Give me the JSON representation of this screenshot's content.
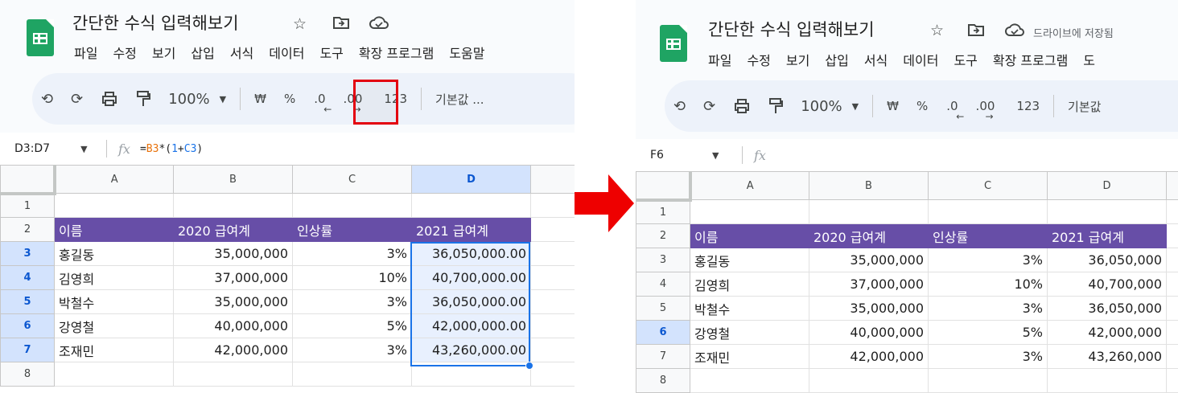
{
  "left": {
    "doc_title": "간단한 수식 입력해보기",
    "menu": [
      "파일",
      "수정",
      "보기",
      "삽입",
      "서식",
      "데이터",
      "도구",
      "확장 프로그램",
      "도움말"
    ],
    "toolbar": {
      "zoom": "100%",
      "currency": "₩",
      "percent": "%",
      "dec_decrease": ".0",
      "dec_increase": ".00",
      "num_format": "123",
      "font": "기본값 ..."
    },
    "name_box": "D3:D7",
    "fx_label": "fx",
    "formula": {
      "eq": "=",
      "ref1": "B3",
      "op1": "*(",
      "num": "1",
      "op2": "+",
      "ref2": "C3",
      "close": ")"
    },
    "columns": [
      "A",
      "B",
      "C",
      "D"
    ],
    "row_numbers": [
      "1",
      "2",
      "3",
      "4",
      "5",
      "6",
      "7",
      "8"
    ],
    "header": [
      "이름",
      "2020 급여계",
      "인상률",
      "2021 급여계"
    ],
    "rows": [
      [
        "홍길동",
        "35,000,000",
        "3%",
        "36,050,000.00"
      ],
      [
        "김영희",
        "37,000,000",
        "10%",
        "40,700,000.00"
      ],
      [
        "박철수",
        "35,000,000",
        "3%",
        "36,050,000.00"
      ],
      [
        "강영철",
        "40,000,000",
        "5%",
        "42,000,000.00"
      ],
      [
        "조재민",
        "42,000,000",
        "3%",
        "43,260,000.00"
      ]
    ]
  },
  "right": {
    "doc_title": "간단한 수식 입력해보기",
    "saved_status": "드라이브에 저장됨",
    "menu": [
      "파일",
      "수정",
      "보기",
      "삽입",
      "서식",
      "데이터",
      "도구",
      "확장 프로그램",
      "도"
    ],
    "toolbar": {
      "zoom": "100%",
      "currency": "₩",
      "percent": "%",
      "dec_decrease": ".0",
      "dec_increase": ".00",
      "num_format": "123",
      "font": "기본값"
    },
    "name_box": "F6",
    "fx_label": "fx",
    "columns": [
      "A",
      "B",
      "C",
      "D"
    ],
    "row_numbers": [
      "1",
      "2",
      "3",
      "4",
      "5",
      "6",
      "7",
      "8"
    ],
    "header": [
      "이름",
      "2020 급여계",
      "인상률",
      "2021 급여계"
    ],
    "rows": [
      [
        "홍길동",
        "35,000,000",
        "3%",
        "36,050,000"
      ],
      [
        "김영희",
        "37,000,000",
        "10%",
        "40,700,000"
      ],
      [
        "박철수",
        "35,000,000",
        "3%",
        "36,050,000"
      ],
      [
        "강영철",
        "40,000,000",
        "5%",
        "42,000,000"
      ],
      [
        "조재민",
        "42,000,000",
        "3%",
        "43,260,000"
      ]
    ]
  },
  "colors": {
    "header_purple": "#674ea7",
    "selection_blue": "#1a73e8",
    "highlight_red": "#e3000f",
    "arrow_red": "#ee0000",
    "sheets_green": "#1fa463"
  }
}
